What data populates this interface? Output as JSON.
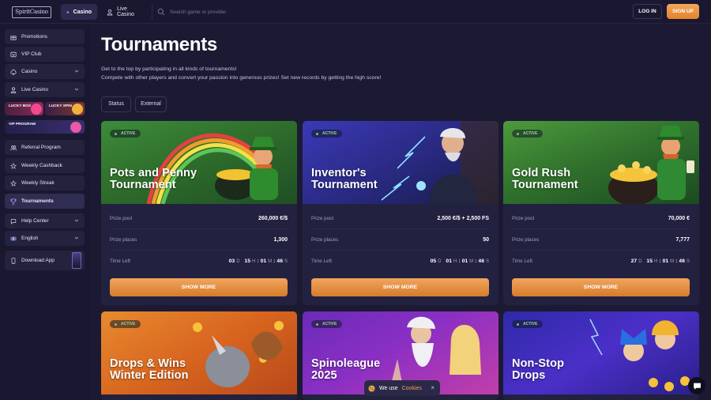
{
  "header": {
    "logo_text": "SpiritCasino",
    "tab_casino": "Casino",
    "tab_live": "Live Casino",
    "search_placeholder": "Search game or provider",
    "login": "LOG IN",
    "signup": "SIGN UP"
  },
  "sidebar": {
    "items": [
      {
        "label": "Promotions",
        "icon": "gift-icon"
      },
      {
        "label": "VIP Club",
        "icon": "vip-icon"
      },
      {
        "label": "Casino",
        "icon": "spade-icon"
      },
      {
        "label": "Live Casino",
        "icon": "dealer-icon"
      },
      {
        "label": "Referral Program",
        "icon": "users-icon"
      },
      {
        "label": "Weekly Cashback",
        "icon": "cashback-icon"
      },
      {
        "label": "Weekly Streak",
        "icon": "streak-icon"
      },
      {
        "label": "Tournaments",
        "icon": "trophy-icon"
      },
      {
        "label": "Help Center",
        "icon": "help-icon"
      },
      {
        "label": "English",
        "icon": "flag-icon"
      },
      {
        "label": "Download App",
        "icon": "phone-icon"
      }
    ],
    "promos": {
      "lucky_box": "LUCKY BOX",
      "lucky_spin": "LUCKY SPIN",
      "vip_program": "VIP PROGRAM"
    }
  },
  "page": {
    "title": "Tournaments",
    "desc_line1": "Get to the top by participating in all kinds of tournaments!",
    "desc_line2": "Compete with other players and convert your passion into generous prizes! Set new records by getting the high score!",
    "filter_status": "Status",
    "filter_external": "External"
  },
  "labels": {
    "prize_pool": "Prize pool",
    "prize_places": "Prize places",
    "time_left": "Time Left",
    "show_more": "SHOW MORE",
    "d": "D",
    "h": "H",
    "m": "M",
    "s": "S"
  },
  "cards": [
    {
      "badge": "ACTIVE",
      "title1": "Pots and Penny",
      "title2": "Tournament",
      "pool": "260,000 €/$",
      "places": "1,300",
      "days": "03",
      "hours": "15",
      "mins": "01",
      "secs": "46"
    },
    {
      "badge": "ACTIVE",
      "title1": "Inventor's",
      "title2": "Tournament",
      "pool": "2,500 €/$ + 2,500 FS",
      "places": "50",
      "days": "05",
      "hours": "01",
      "mins": "01",
      "secs": "46"
    },
    {
      "badge": "ACTIVE",
      "title1": "Gold Rush",
      "title2": "Tournament",
      "pool": "70,000 €",
      "places": "7,777",
      "days": "27",
      "hours": "15",
      "mins": "01",
      "secs": "46"
    },
    {
      "badge": "ACTIVE",
      "title1": "Drops & Wins",
      "title2": "Winter Edition"
    },
    {
      "badge": "ACTIVE",
      "title1": "Spinoleague",
      "title2": "2025"
    },
    {
      "badge": "ACTIVE",
      "title1": "Non-Stop",
      "title2": "Drops"
    }
  ],
  "cookie": {
    "text": "We use",
    "link": "Cookies",
    "close": "×"
  },
  "colors": {
    "accent": "#e98a33",
    "bg": "#1c1a33",
    "card": "#232140",
    "active_badge": "#5fd35f"
  }
}
